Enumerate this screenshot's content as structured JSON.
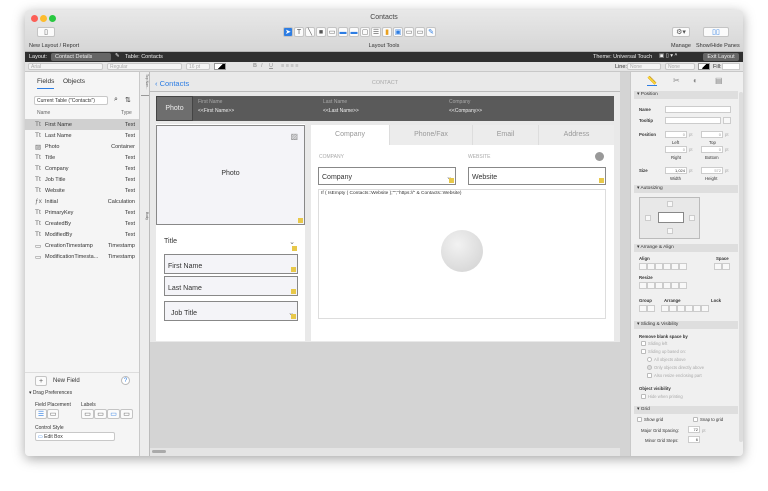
{
  "window": {
    "title": "Contacts"
  },
  "toolbar": {
    "new_layout": "New Layout / Report",
    "layout_tools": "Layout Tools",
    "manage": "Manage",
    "show_hide": "Show/Hide Panes"
  },
  "layout_bar": {
    "layout_label": "Layout:",
    "layout_value": "Contact Details",
    "table": "Table: Contacts",
    "theme": "Theme: Universal Touch",
    "exit": "Exit Layout"
  },
  "format_bar": {
    "font": "Arial",
    "style": "Regular",
    "size": "16 pt",
    "bold": "B",
    "italic": "I",
    "underline": "U",
    "line_label": "Line:",
    "line_value": "None",
    "line_value2": "None",
    "fill_label": "Fill:"
  },
  "left_pane": {
    "tabs": [
      "Fields",
      "Objects"
    ],
    "table_select": "Current Table (\"Contacts\")",
    "col_name": "Name",
    "col_type": "Type",
    "fields": [
      {
        "name": "First Name",
        "type": "Text",
        "icon": "text-icon",
        "selected": true
      },
      {
        "name": "Last Name",
        "type": "Text",
        "icon": "text-icon"
      },
      {
        "name": "Photo",
        "type": "Container",
        "icon": "container-icon"
      },
      {
        "name": "Title",
        "type": "Text",
        "icon": "text-icon"
      },
      {
        "name": "Company",
        "type": "Text",
        "icon": "text-icon"
      },
      {
        "name": "Job Title",
        "type": "Text",
        "icon": "text-icon"
      },
      {
        "name": "Website",
        "type": "Text",
        "icon": "text-icon"
      },
      {
        "name": "Initial",
        "type": "Calculation",
        "icon": "calculation-icon"
      },
      {
        "name": "PrimaryKey",
        "type": "Text",
        "icon": "text-icon"
      },
      {
        "name": "CreatedBy",
        "type": "Text",
        "icon": "text-icon"
      },
      {
        "name": "ModifiedBy",
        "type": "Text",
        "icon": "text-icon"
      },
      {
        "name": "CreationTimestamp",
        "type": "Timestamp",
        "icon": "timestamp-icon"
      },
      {
        "name": "ModificationTimesta...",
        "type": "Timestamp",
        "icon": "timestamp-icon"
      }
    ],
    "new_field": "New Field",
    "drag_prefs": "Drag Preferences",
    "field_placement": "Field Placement",
    "labels": "Labels",
    "control_style": "Control Style",
    "control_value": "Edit Box"
  },
  "layout": {
    "back": "Contacts",
    "header": "CONTACT",
    "part_top": "Top Nav...",
    "part_body": "Body",
    "band": {
      "photo": "Photo",
      "f1_label": "First Name",
      "f1_value": "<<First Name>>",
      "f2_label": "Last Name",
      "f2_value": "<<Last Name>>",
      "f3_label": "Company",
      "f3_value": "<<Company>>"
    },
    "photo": "Photo",
    "fields": [
      "Title",
      "First Name",
      "Last Name",
      "Job Title"
    ],
    "tabs": [
      "Company",
      "Phone/Fax",
      "Email",
      "Address"
    ],
    "company_label": "COMPANY",
    "website_label": "WEBSITE",
    "company_field": "Company",
    "website_field": "Website",
    "calc": "If ( IsEmpty ( Contacts::Website );\"\";\"https://\" & Contacts::Website)"
  },
  "inspector": {
    "position": "Position",
    "name": "Name",
    "tooltip": "Tooltip",
    "position_label": "Position",
    "left": "Left",
    "top": "Top",
    "right": "Right",
    "bottom": "Bottom",
    "left_v": "0",
    "top_v": "0",
    "right_v": "0",
    "bottom_v": "0",
    "unit": "pt",
    "size": "Size",
    "width": "Width",
    "height": "Height",
    "width_v": "1,024",
    "height_v": "572",
    "autosizing": "Autosizing",
    "arrange": "Arrange & Align",
    "align": "Align",
    "space": "Space",
    "resize": "Resize",
    "group": "Group",
    "arrange_l": "Arrange",
    "lock": "Lock",
    "sliding": "Sliding & Visibility",
    "remove_blank": "Remove blank space by",
    "sliding_left": "Sliding left",
    "sliding_up": "Sliding up based on:",
    "all_above": "All objects above",
    "only_above": "Only objects directly above",
    "also_resize": "Also resize enclosing part",
    "obj_vis": "Object visibility",
    "hide_print": "Hide when printing",
    "grid": "Grid",
    "show_grid": "Show grid",
    "snap_grid": "Snap to grid",
    "major": "Major Grid Spacing:",
    "major_v": "72",
    "minor": "Minor Grid Steps:",
    "minor_v": "6"
  }
}
